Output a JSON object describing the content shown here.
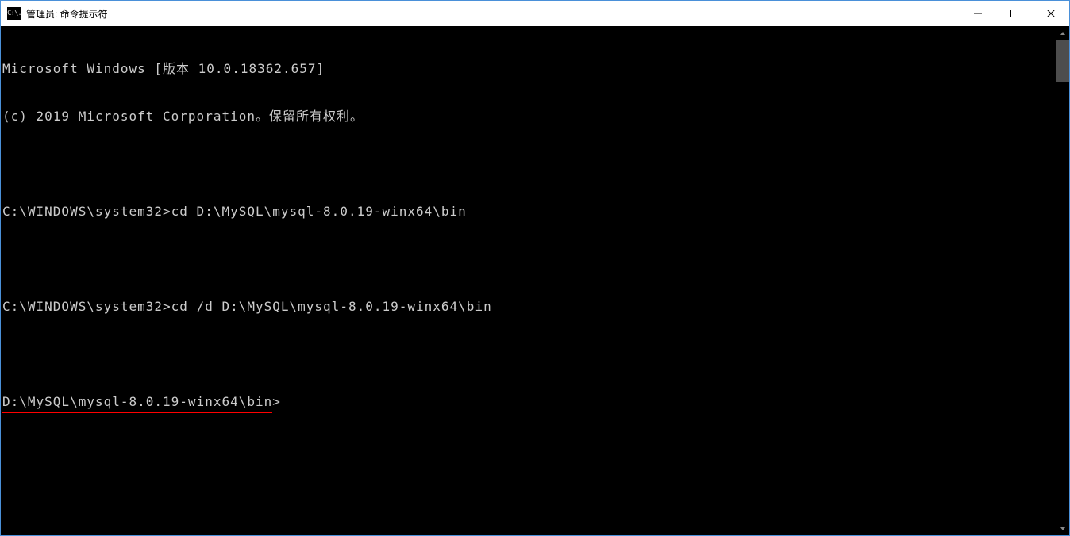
{
  "title": "管理员: 命令提示符",
  "app_icon_text": "C:\\.",
  "terminal": {
    "line1": "Microsoft Windows [版本 10.0.18362.657]",
    "line2": "(c) 2019 Microsoft Corporation。保留所有权利。",
    "prompt1": "C:\\WINDOWS\\system32>",
    "cmd1": "cd D:\\MySQL\\mysql-8.0.19-winx64\\bin",
    "prompt2": "C:\\WINDOWS\\system32>",
    "cmd2": "cd /d D:\\MySQL\\mysql-8.0.19-winx64\\bin",
    "prompt3_underlined": "D:\\MySQL\\mysql-8.0.19-winx64\\bin",
    "prompt3_tail": ">"
  }
}
